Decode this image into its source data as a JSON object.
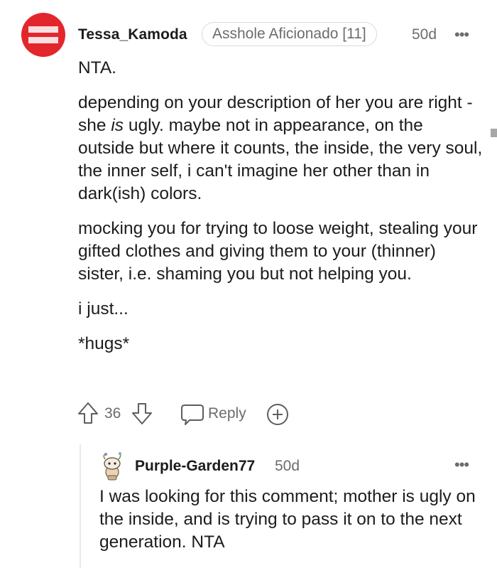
{
  "comment": {
    "username": "Tessa_Kamoda",
    "flair": "Asshole Aficionado [11]",
    "age": "50d",
    "more": "•••",
    "paragraphs": [
      "NTA.",
      "depending on your description of her you are right - she ",
      "ugly. maybe not in appearance, on the outside but where it counts, the inside, the very soul, the inner self, i can't imagine her other than in dark(ish) colors.",
      "mocking you for trying to loose weight, stealing your gifted clothes and giving them to your (thinner) sister, i.e. shaming you but not helping you.",
      "i just...",
      "*hugs*"
    ],
    "emphasis": "is",
    "score": "36",
    "reply_label": "Reply"
  },
  "reply": {
    "username": "Purple-Garden77",
    "age": "50d",
    "more": "•••",
    "body": "I was looking for this comment; mother is ugly on the inside, and is trying to pass it on to the next generation. NTA"
  },
  "colors": {
    "avatar_red": "#e3262c",
    "muted_text": "#6a6c6e",
    "body_text": "#1c1c1c"
  },
  "icons": [
    "upvote-icon",
    "downvote-icon",
    "comment-icon",
    "award-icon",
    "more-icon"
  ]
}
